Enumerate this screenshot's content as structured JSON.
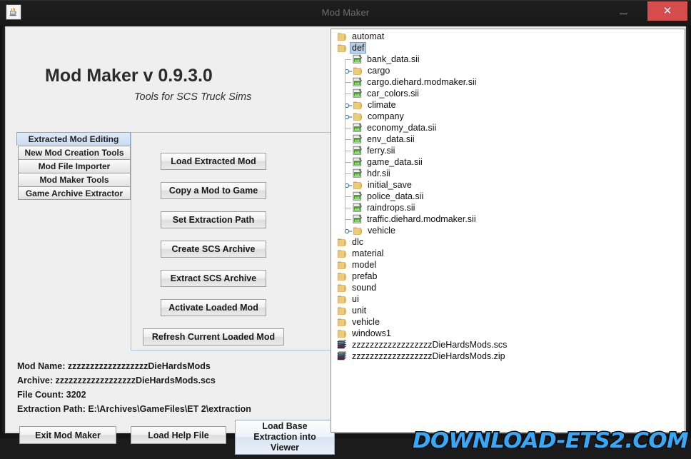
{
  "window": {
    "title": "Mod Maker",
    "icon": "java-coffee-cup-icon",
    "minimize_label": "",
    "maximize_label": "",
    "close_label": "✕"
  },
  "header": {
    "title": "Mod Maker v 0.9.3.0",
    "subtitle": "Tools for SCS Truck Sims"
  },
  "tabs": [
    {
      "label": "Extracted Mod Editing",
      "selected": true
    },
    {
      "label": "New Mod Creation Tools",
      "selected": false
    },
    {
      "label": "Mod File Importer",
      "selected": false
    },
    {
      "label": "Mod Maker Tools",
      "selected": false
    },
    {
      "label": "Game Archive Extractor",
      "selected": false
    }
  ],
  "action_buttons": [
    {
      "label": "Load Extracted Mod",
      "size": "norm"
    },
    {
      "label": "Copy a Mod to Game",
      "size": "norm"
    },
    {
      "label": "Set Extraction Path",
      "size": "norm"
    },
    {
      "label": "Create SCS Archive",
      "size": "norm"
    },
    {
      "label": "Extract SCS Archive",
      "size": "norm"
    },
    {
      "label": "Activate Loaded Mod",
      "size": "norm"
    },
    {
      "label": "Refresh Current Loaded Mod",
      "size": "wide"
    }
  ],
  "info": {
    "mod_name": "Mod Name: zzzzzzzzzzzzzzzzzzDieHardsMods",
    "archive": "Archive: zzzzzzzzzzzzzzzzzzDieHardsMods.scs",
    "file_count": "File Count: 3202",
    "extraction_path": "Extraction Path: E:\\Archives\\GameFiles\\ET 2\\extraction"
  },
  "bottom_buttons": {
    "exit": "Exit Mod Maker",
    "help": "Load Help File",
    "load_base_line1": "Load Base",
    "load_base_line2": "Extraction into",
    "load_base_line3": "Viewer"
  },
  "watermark": {
    "text": "DOWNLOAD-ETS2.COM",
    "color": "#3aa7f5",
    "outline": "#0b0b0b"
  },
  "tree": {
    "nodes": [
      {
        "label": "automat",
        "depth": 0,
        "type": "folder",
        "handle": "none",
        "selected": false
      },
      {
        "label": "def",
        "depth": 0,
        "type": "folder",
        "handle": "none",
        "selected": true
      },
      {
        "label": "bank_data.sii",
        "depth": 1,
        "type": "sii",
        "handle": "leaf",
        "selected": false
      },
      {
        "label": "cargo",
        "depth": 1,
        "type": "folder",
        "handle": "collapsed",
        "selected": false
      },
      {
        "label": "cargo.diehard.modmaker.sii",
        "depth": 1,
        "type": "sii",
        "handle": "leaf",
        "selected": false
      },
      {
        "label": "car_colors.sii",
        "depth": 1,
        "type": "sii",
        "handle": "leaf",
        "selected": false
      },
      {
        "label": "climate",
        "depth": 1,
        "type": "folder",
        "handle": "collapsed",
        "selected": false
      },
      {
        "label": "company",
        "depth": 1,
        "type": "folder",
        "handle": "collapsed",
        "selected": false
      },
      {
        "label": "economy_data.sii",
        "depth": 1,
        "type": "sii",
        "handle": "leaf",
        "selected": false
      },
      {
        "label": "env_data.sii",
        "depth": 1,
        "type": "sii",
        "handle": "leaf",
        "selected": false
      },
      {
        "label": "ferry.sii",
        "depth": 1,
        "type": "sii",
        "handle": "leaf",
        "selected": false
      },
      {
        "label": "game_data.sii",
        "depth": 1,
        "type": "sii",
        "handle": "leaf",
        "selected": false
      },
      {
        "label": "hdr.sii",
        "depth": 1,
        "type": "sii",
        "handle": "leaf",
        "selected": false
      },
      {
        "label": "initial_save",
        "depth": 1,
        "type": "folder",
        "handle": "collapsed",
        "selected": false
      },
      {
        "label": "police_data.sii",
        "depth": 1,
        "type": "sii",
        "handle": "leaf",
        "selected": false
      },
      {
        "label": "raindrops.sii",
        "depth": 1,
        "type": "sii",
        "handle": "leaf",
        "selected": false
      },
      {
        "label": "traffic.diehard.modmaker.sii",
        "depth": 1,
        "type": "sii",
        "handle": "leaf",
        "selected": false
      },
      {
        "label": "vehicle",
        "depth": 1,
        "type": "folder",
        "handle": "collapsed",
        "selected": false
      },
      {
        "label": "dlc",
        "depth": 0,
        "type": "folder",
        "handle": "none",
        "selected": false
      },
      {
        "label": "material",
        "depth": 0,
        "type": "folder",
        "handle": "none",
        "selected": false
      },
      {
        "label": "model",
        "depth": 0,
        "type": "folder",
        "handle": "none",
        "selected": false
      },
      {
        "label": "prefab",
        "depth": 0,
        "type": "folder",
        "handle": "none",
        "selected": false
      },
      {
        "label": "sound",
        "depth": 0,
        "type": "folder",
        "handle": "none",
        "selected": false
      },
      {
        "label": "ui",
        "depth": 0,
        "type": "folder",
        "handle": "none",
        "selected": false
      },
      {
        "label": "unit",
        "depth": 0,
        "type": "folder",
        "handle": "none",
        "selected": false
      },
      {
        "label": "vehicle",
        "depth": 0,
        "type": "folder",
        "handle": "none",
        "selected": false
      },
      {
        "label": "windows1",
        "depth": 0,
        "type": "folder",
        "handle": "none",
        "selected": false
      },
      {
        "label": "zzzzzzzzzzzzzzzzzzDieHardsMods.scs",
        "depth": 0,
        "type": "archive",
        "handle": "none",
        "selected": false
      },
      {
        "label": "zzzzzzzzzzzzzzzzzzDieHardsMods.zip",
        "depth": 0,
        "type": "archive",
        "handle": "none",
        "selected": false
      }
    ]
  }
}
